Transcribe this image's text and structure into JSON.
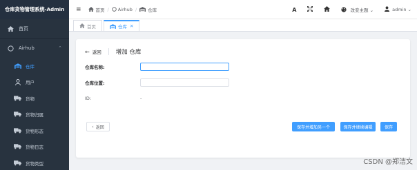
{
  "app": {
    "title": "仓库货物管理系统-Admin"
  },
  "sidebar": {
    "home": {
      "label": "首页",
      "icon": "home-icon"
    },
    "group": {
      "label": "Airhub",
      "icon": "circle-icon",
      "caret": "⌃"
    },
    "items": [
      {
        "label": "仓库",
        "icon": "warehouse-icon",
        "active": true
      },
      {
        "label": "用户",
        "icon": "user-icon"
      },
      {
        "label": "货物",
        "icon": "truck-icon"
      },
      {
        "label": "货物归属",
        "icon": "truck-icon"
      },
      {
        "label": "货物形态",
        "icon": "truck-icon"
      },
      {
        "label": "货物日志",
        "icon": "truck-icon"
      },
      {
        "label": "货物类型",
        "icon": "truck-icon"
      }
    ]
  },
  "topbar": {
    "breadcrumb": {
      "home": "首页",
      "sep": "/",
      "group": "Airhub",
      "current": "仓库"
    },
    "font_size_glyph": "A",
    "theme_label": "改变主题",
    "user_label": "admin"
  },
  "tabs": [
    {
      "label": "首页"
    },
    {
      "label": "仓库",
      "close": "✕",
      "active": true
    }
  ],
  "page": {
    "back_label": "返回",
    "title": "增加 仓库",
    "fields": {
      "name": {
        "label": "仓库名称:",
        "value": ""
      },
      "location": {
        "label": "仓库位置:",
        "value": ""
      },
      "id": {
        "label": "ID:",
        "value": "-"
      }
    },
    "buttons": {
      "back": "返回",
      "save_add": "保存并增加另一个",
      "save_edit": "保存并继续编辑",
      "save": "保存"
    }
  },
  "watermark": "CSDN @郑洁文",
  "colors": {
    "primary": "#409eff",
    "sidebar_bg": "#28333f",
    "brand_bg": "#243040"
  }
}
